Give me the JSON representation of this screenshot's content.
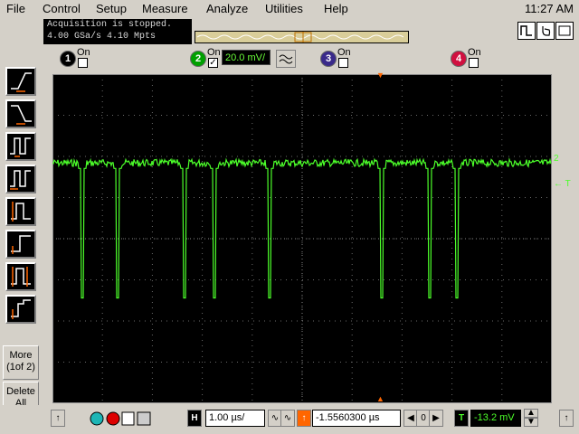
{
  "menu": [
    "File",
    "Control",
    "Setup",
    "Measure",
    "Analyze",
    "Utilities",
    "Help"
  ],
  "clock": "11:27 AM",
  "status": {
    "line1": "Acquisition is stopped.",
    "line2": "4.00 GSa/s   4.10 Mpts"
  },
  "channels": [
    {
      "num": "1",
      "on_label": "On",
      "checked": false,
      "color": "#000000"
    },
    {
      "num": "2",
      "on_label": "On",
      "checked": true,
      "color": "#00b000",
      "scale": "20.0 mV/"
    },
    {
      "num": "3",
      "on_label": "On",
      "checked": false,
      "color": "#3a2a8a"
    },
    {
      "num": "4",
      "on_label": "On",
      "checked": false,
      "color": "#d01040"
    }
  ],
  "left_toolbar": {
    "more_label": "More (1of 2)",
    "delete_label": "Delete All"
  },
  "scope": {
    "trace_color": "#4cff2a",
    "grid_color": "#6a6a6a",
    "marker_ch": "2",
    "marker_trigger": "T",
    "baseline_level": 0.27,
    "pulse_level": 0.68,
    "pulse_positions": [
      0.06,
      0.13,
      0.265,
      0.325,
      0.435,
      0.66,
      0.755,
      0.81
    ]
  },
  "bottom": {
    "h_label": "H",
    "timebase": "1.00 µs/",
    "delay": "-1.5560300 µs",
    "t_label": "T",
    "trigger_level": "-13.2 mV"
  }
}
